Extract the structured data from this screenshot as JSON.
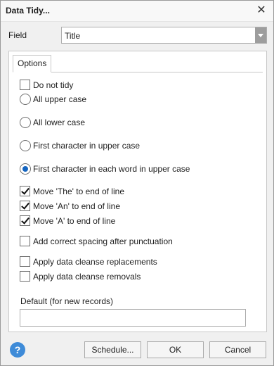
{
  "window": {
    "title": "Data Tidy...",
    "close_glyph": "✕"
  },
  "field": {
    "label": "Field",
    "value": "Title"
  },
  "options_tab": {
    "label": "Options"
  },
  "options": {
    "do_not_tidy": {
      "label": "Do not tidy",
      "checked": false
    },
    "case_choices": [
      {
        "label": "All upper case",
        "selected": false
      },
      {
        "label": "All lower case",
        "selected": false
      },
      {
        "label": "First character in upper case",
        "selected": false
      },
      {
        "label": "First character in each word in upper case",
        "selected": true
      }
    ],
    "move_the": {
      "label": "Move 'The' to end of line",
      "checked": true
    },
    "move_an": {
      "label": "Move 'An' to end of line",
      "checked": true
    },
    "move_a": {
      "label": "Move 'A' to end of line",
      "checked": true
    },
    "correct_spacing": {
      "label": "Add correct spacing after punctuation",
      "checked": false
    },
    "cleanse_replacements": {
      "label": "Apply data cleanse replacements",
      "checked": false
    },
    "cleanse_removals": {
      "label": "Apply data cleanse removals",
      "checked": false
    }
  },
  "default_field": {
    "label": "Default (for new records)",
    "value": ""
  },
  "footer": {
    "help_glyph": "?",
    "schedule_label": "Schedule...",
    "ok_label": "OK",
    "cancel_label": "Cancel"
  },
  "colors": {
    "accent": "#1565c0",
    "help_icon": "#3e8bd8"
  }
}
